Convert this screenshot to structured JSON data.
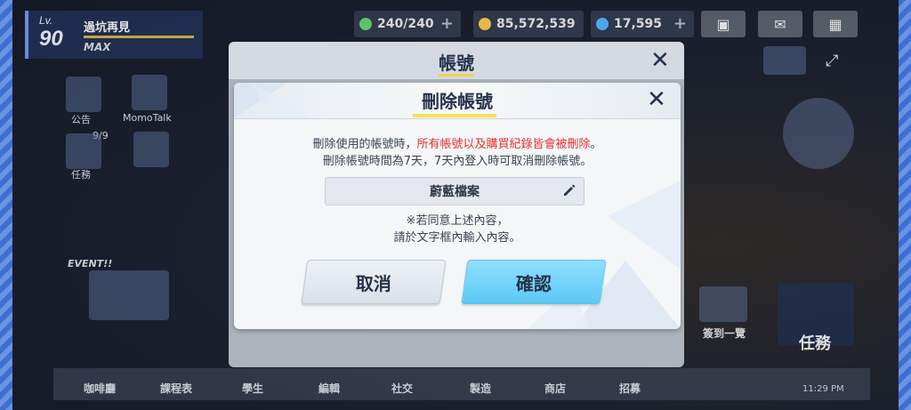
{
  "hud": {
    "level_prefix": "Lv.",
    "level": "90",
    "player_name": "過坑再見",
    "level_max": "MAX",
    "stamina": "240/240",
    "credits": "85,572,539",
    "gems": "17,595",
    "colors": {
      "stamina": "#5fc26a",
      "credits": "#e7b84a",
      "gems": "#4aa8e8"
    }
  },
  "sidebar": {
    "notice": "公告",
    "momotalk": "MomoTalk",
    "mission_count": "9/9",
    "task": "任務",
    "event": "EVENT!!"
  },
  "bottom_nav": [
    {
      "label": "咖啡廳"
    },
    {
      "label": "課程表"
    },
    {
      "label": "學生"
    },
    {
      "label": "編輯"
    },
    {
      "label": "社交"
    },
    {
      "label": "製造"
    },
    {
      "label": "商店"
    },
    {
      "label": "招募"
    }
  ],
  "status": {
    "time": "11:29 PM"
  },
  "side_right": {
    "checkin": "簽到一覽",
    "mission": "任務"
  },
  "outer_dialog": {
    "title": "帳號",
    "close_icon": "close-icon"
  },
  "inner_dialog": {
    "title": "刪除帳號",
    "close_icon": "close-icon",
    "line1_prefix": "刪除使用的帳號時，",
    "line1_warning": "所有帳號以及購買紀錄皆會被刪除",
    "line1_suffix": "。",
    "line2": "刪除帳號時間為7天，7天內登入時可取消刪除帳號。",
    "input_value": "蔚藍檔案",
    "input_icon": "pencil-icon",
    "hint_line1": "※若同意上述內容，",
    "hint_line2": "請於文字框內輸入內容。",
    "cancel_label": "取消",
    "confirm_label": "確認",
    "colors": {
      "warning": "#e5322f",
      "confirm_button": "#5cc8f4",
      "title_underline": "#f3df58"
    }
  }
}
